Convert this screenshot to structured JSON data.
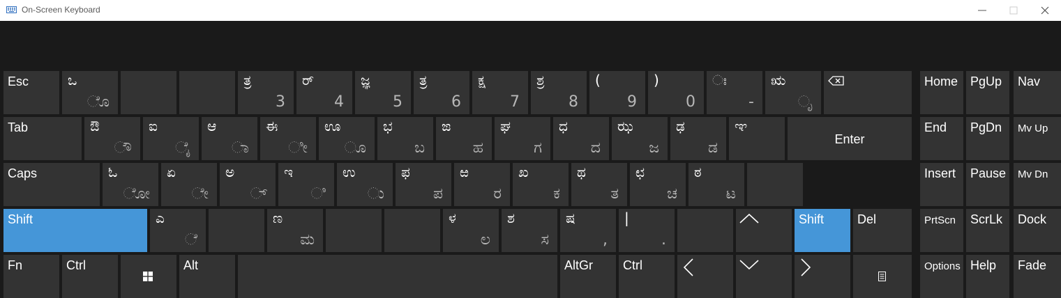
{
  "window": {
    "title": "On-Screen Keyboard",
    "controls": [
      "minimize",
      "maximize",
      "close"
    ]
  },
  "colors": {
    "background": "#1a1a1a",
    "key": "#333333",
    "active_key": "#4596d8",
    "titlebar": "#ffffff"
  },
  "keys": {
    "esc": {
      "label": "Esc"
    },
    "k1": {
      "top": "ಒ",
      "bottom": "ೊ"
    },
    "k2": {
      "top": "",
      "bottom": ""
    },
    "k3": {
      "top": "",
      "bottom": ""
    },
    "k4": {
      "top": "ತ್ರ",
      "bottom": "3"
    },
    "k5": {
      "top": "ರ್",
      "bottom": "4"
    },
    "k6": {
      "top": "ಜ್ಞ",
      "bottom": "5"
    },
    "k7": {
      "top": "ತ್ರ",
      "bottom": "6"
    },
    "k8": {
      "top": "ಕ್ಷ",
      "bottom": "7"
    },
    "k9": {
      "top": "ಶ್ರ",
      "bottom": "8"
    },
    "k10": {
      "top": "(",
      "bottom": "9"
    },
    "k11": {
      "top": ")",
      "bottom": "0"
    },
    "k12": {
      "top": "ಃ",
      "bottom": "-"
    },
    "k13": {
      "top": "ಋ",
      "bottom": "ೃ"
    },
    "backspace": {
      "label": "⌫"
    },
    "home": {
      "label": "Home"
    },
    "pgup": {
      "label": "PgUp"
    },
    "nav": {
      "label": "Nav"
    },
    "tab": {
      "label": "Tab"
    },
    "q": {
      "top": "ಔ",
      "bottom": "ೌ"
    },
    "w": {
      "top": "ಐ",
      "bottom": "ೈ"
    },
    "e": {
      "top": "ಆ",
      "bottom": "ಾ"
    },
    "r": {
      "top": "ಈ",
      "bottom": "ೀ"
    },
    "t": {
      "top": "ಊ",
      "bottom": "ೂ"
    },
    "y": {
      "top": "ಭ",
      "bottom": "ಬ"
    },
    "u": {
      "top": "ಙ",
      "bottom": "ಹ"
    },
    "i": {
      "top": "ಘ",
      "bottom": "ಗ"
    },
    "o": {
      "top": "ಧ",
      "bottom": "ದ"
    },
    "p": {
      "top": "ಝ",
      "bottom": "ಜ"
    },
    "lbracket": {
      "top": "ಢ",
      "bottom": "ಡ"
    },
    "rbracket": {
      "top": "ಞ",
      "bottom": ""
    },
    "enter": {
      "label": "Enter"
    },
    "end": {
      "label": "End"
    },
    "pgdn": {
      "label": "PgDn"
    },
    "mvup": {
      "label": "Mv Up"
    },
    "caps": {
      "label": "Caps"
    },
    "a": {
      "top": "ಓ",
      "bottom": "ೋ"
    },
    "s": {
      "top": "ಏ",
      "bottom": "ೇ"
    },
    "d": {
      "top": "ಅ",
      "bottom": "್"
    },
    "f": {
      "top": "ಇ",
      "bottom": "ಿ"
    },
    "g": {
      "top": "ಉ",
      "bottom": "ು"
    },
    "h": {
      "top": "ಫ",
      "bottom": "ಪ"
    },
    "j": {
      "top": "ಱ",
      "bottom": "ರ"
    },
    "k": {
      "top": "ಖ",
      "bottom": "ಕ"
    },
    "l": {
      "top": "ಥ",
      "bottom": "ತ"
    },
    "semicolon": {
      "top": "ಛ",
      "bottom": "ಚ"
    },
    "quote": {
      "top": "ಠ",
      "bottom": "ಟ"
    },
    "backslash": {
      "top": "",
      "bottom": ""
    },
    "insert": {
      "label": "Insert"
    },
    "pause": {
      "label": "Pause"
    },
    "mvdn": {
      "label": "Mv Dn"
    },
    "lshift": {
      "label": "Shift"
    },
    "z": {
      "top": "ಎ",
      "bottom": "ೆ"
    },
    "x": {
      "top": "",
      "bottom": ""
    },
    "c": {
      "top": "ಣ",
      "bottom": "ಮ"
    },
    "v": {
      "top": "",
      "bottom": ""
    },
    "b": {
      "top": "",
      "bottom": ""
    },
    "n": {
      "top": "ಳ",
      "bottom": "ಲ"
    },
    "m": {
      "top": "ಶ",
      "bottom": "ಸ"
    },
    "comma": {
      "top": "ಷ",
      "bottom": ","
    },
    "period": {
      "top": "|",
      "bottom": "."
    },
    "slash": {
      "top": "",
      "bottom": ""
    },
    "up": {
      "label": "^"
    },
    "rshift": {
      "label": "Shift"
    },
    "del": {
      "label": "Del"
    },
    "prtscn": {
      "label": "PrtScn"
    },
    "scrlk": {
      "label": "ScrLk"
    },
    "dock": {
      "label": "Dock"
    },
    "fn": {
      "label": "Fn"
    },
    "lctrl": {
      "label": "Ctrl"
    },
    "win": {
      "label": ""
    },
    "alt": {
      "label": "Alt"
    },
    "space": {
      "label": ""
    },
    "altgr": {
      "label": "AltGr"
    },
    "rctrl": {
      "label": "Ctrl"
    },
    "left": {
      "label": "<"
    },
    "down": {
      "label": "v"
    },
    "right": {
      "label": ">"
    },
    "menu": {
      "label": ""
    },
    "options": {
      "label": "Options"
    },
    "help": {
      "label": "Help"
    },
    "fade": {
      "label": "Fade"
    }
  }
}
